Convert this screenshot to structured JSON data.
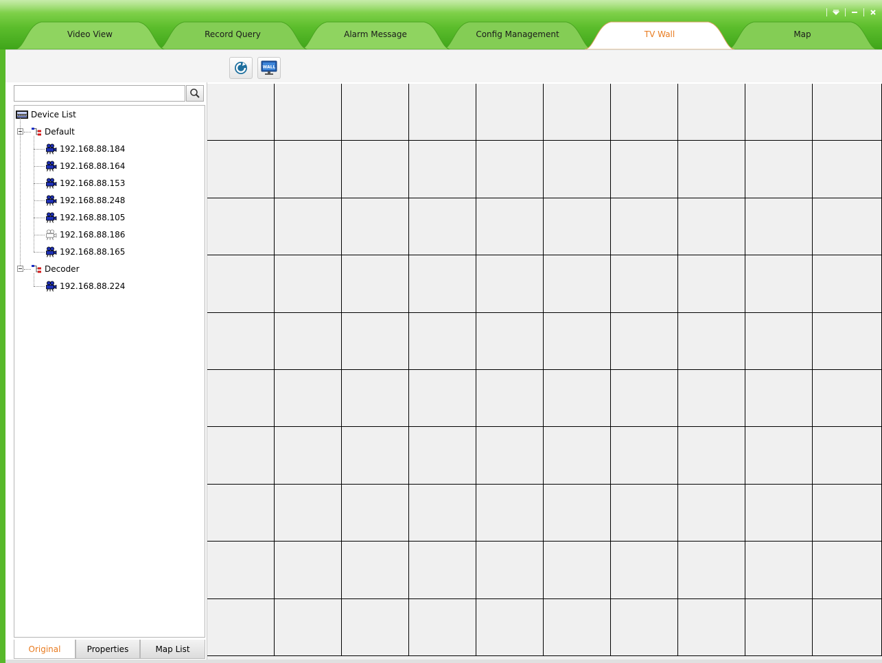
{
  "window": {
    "controls": [
      "menu",
      "minimize",
      "close"
    ],
    "accent_green": "#5cbd2c",
    "active_tab_color": "#e87a1e"
  },
  "tabs": [
    {
      "label": "Video View",
      "active": false
    },
    {
      "label": "Record Query",
      "active": false
    },
    {
      "label": "Alarm Message",
      "active": false
    },
    {
      "label": "Config Management",
      "active": false
    },
    {
      "label": "TV Wall",
      "active": true
    },
    {
      "label": "Map",
      "active": false
    }
  ],
  "toolbar": {
    "buttons": [
      {
        "icon": "refresh-icon"
      },
      {
        "icon": "tv-wall-icon",
        "text": "WALL"
      }
    ]
  },
  "search": {
    "value": "",
    "placeholder": ""
  },
  "tree": {
    "root": "Device List",
    "groups": [
      {
        "name": "Default",
        "devices": [
          {
            "ip": "192.168.88.184",
            "online": true
          },
          {
            "ip": "192.168.88.164",
            "online": true
          },
          {
            "ip": "192.168.88.153",
            "online": true
          },
          {
            "ip": "192.168.88.248",
            "online": true
          },
          {
            "ip": "192.168.88.105",
            "online": true
          },
          {
            "ip": "192.168.88.186",
            "online": false
          },
          {
            "ip": "192.168.88.165",
            "online": true
          }
        ]
      },
      {
        "name": "Decoder",
        "devices": [
          {
            "ip": "192.168.88.224",
            "online": true
          }
        ]
      }
    ]
  },
  "bottom_tabs": [
    {
      "label": "Original",
      "active": true
    },
    {
      "label": "Properties",
      "active": false
    },
    {
      "label": "Map List",
      "active": false
    }
  ],
  "tv_wall": {
    "columns": 10,
    "rows": 10
  }
}
